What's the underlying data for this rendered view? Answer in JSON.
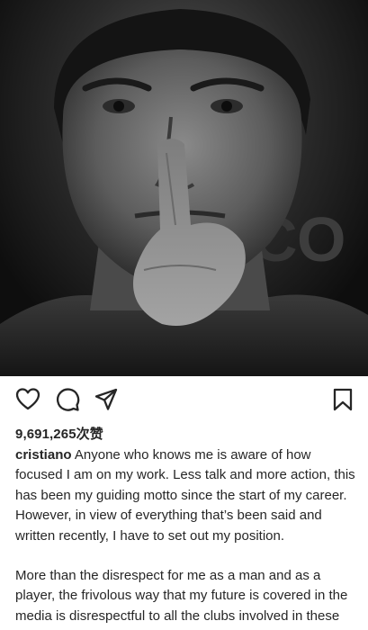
{
  "post": {
    "image_alt": "Black and white portrait photo of a man holding his index finger to his lips",
    "background_letters": "R   O"
  },
  "actions": {
    "like_icon": "heart-icon",
    "comment_icon": "comment-icon",
    "share_icon": "send-icon",
    "save_icon": "bookmark-icon"
  },
  "likes": {
    "count": "9,691,265",
    "suffix": "次赞"
  },
  "caption": {
    "username": "cristiano",
    "paragraph1": "Anyone who knows me is aware of how focused I am on my work. Less talk and more action, this has been my guiding motto since the start of my career. However, in view of everything that’s been said and written recently, I have to set out my position.",
    "paragraph2": "More than the disrespect for me as a man and as a player, the frivolous way that my future is covered in the media is disrespectful to all the clubs involved in these rumours, as well as to their players and staff."
  }
}
